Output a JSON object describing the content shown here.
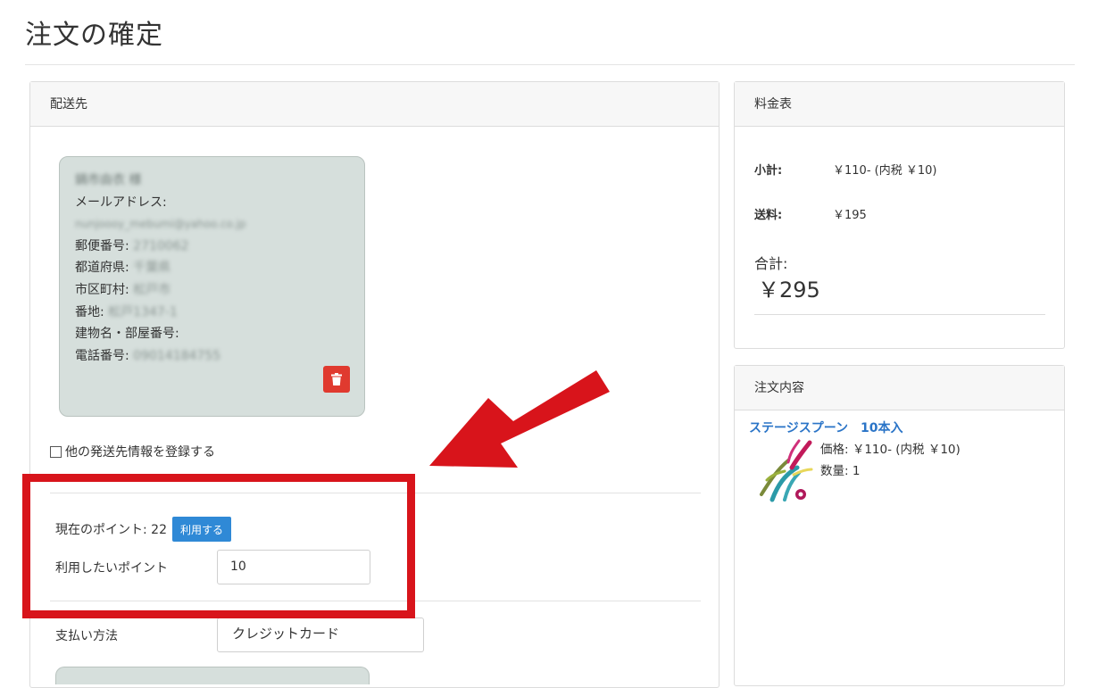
{
  "page": {
    "title": "注文の確定"
  },
  "shipping": {
    "header": "配送先",
    "card": {
      "name": "鍋市由衣 様",
      "email_label": "メールアドレス:",
      "email": "nunjoooy_mebumi@yahoo.co.jp",
      "postal_label": "郵便番号:",
      "postal": "2710062",
      "prefecture_label": "都道府県:",
      "prefecture": "千葉県",
      "city_label": "市区町村:",
      "city": "松戸市",
      "street_label": "番地:",
      "street": "松戸1347-1",
      "building_label": "建物名・部屋番号:",
      "building": "",
      "phone_label": "電話番号:",
      "phone": "09014184755"
    },
    "other_address_label": "他の発送先情報を登録する",
    "points": {
      "current_label": "現在のポイント: 22",
      "use_button": "利用する",
      "use_label": "利用したいポイント",
      "use_value": "10"
    },
    "payment": {
      "label": "支払い方法",
      "value": "クレジットカード"
    }
  },
  "fees": {
    "header": "料金表",
    "subtotal_label": "小計:",
    "subtotal_value": "￥110- (内税 ￥10)",
    "shipping_label": "送料:",
    "shipping_value": "￥195",
    "total_label": "合計:",
    "total_value": "￥295"
  },
  "order": {
    "header": "注文内容",
    "product_name": "ステージスプーン　10本入",
    "price": "価格: ￥110- (内税 ￥10)",
    "quantity": "数量: 1"
  },
  "colors": {
    "highlight_red": "#d8141b",
    "button_blue": "#2f89d6",
    "link_blue": "#2a74c7",
    "delete_red": "#e03a2f",
    "card_bg": "#d6dfdc"
  }
}
